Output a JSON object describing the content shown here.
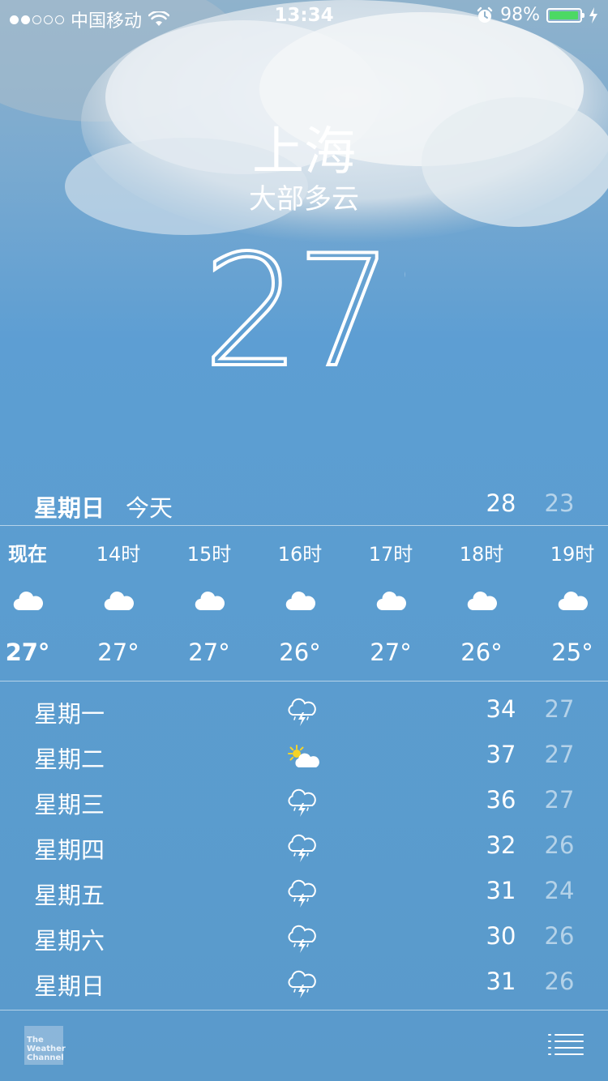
{
  "status_bar": {
    "carrier": "中国移动",
    "time": "13:34",
    "battery": "98%",
    "battery_level": 0.98,
    "signal_bars_filled": 2,
    "signal_bars_total": 5,
    "icons": [
      "wifi-icon",
      "alarm-icon",
      "charging-bolt-icon"
    ]
  },
  "header": {
    "city": "上海",
    "condition": "大部多云",
    "temperature": "27°"
  },
  "today": {
    "day": "星期日",
    "label": "今天",
    "high": "28",
    "low": "23"
  },
  "hourly": [
    {
      "time": "现在",
      "icon": "cloud-icon",
      "temp": "27°"
    },
    {
      "time": "14时",
      "icon": "cloud-icon",
      "temp": "27°"
    },
    {
      "time": "15时",
      "icon": "cloud-icon",
      "temp": "27°"
    },
    {
      "time": "16时",
      "icon": "cloud-icon",
      "temp": "26°"
    },
    {
      "time": "17时",
      "icon": "cloud-icon",
      "temp": "27°"
    },
    {
      "time": "18时",
      "icon": "cloud-icon",
      "temp": "26°"
    },
    {
      "time": "19时",
      "icon": "cloud-icon",
      "temp": "25°"
    }
  ],
  "daily": [
    {
      "day": "星期一",
      "icon": "thunderstorm-icon",
      "high": "34",
      "low": "27"
    },
    {
      "day": "星期二",
      "icon": "partly-sunny-icon",
      "high": "37",
      "low": "27"
    },
    {
      "day": "星期三",
      "icon": "thunderstorm-icon",
      "high": "36",
      "low": "27"
    },
    {
      "day": "星期四",
      "icon": "thunderstorm-icon",
      "high": "32",
      "low": "26"
    },
    {
      "day": "星期五",
      "icon": "thunderstorm-icon",
      "high": "31",
      "low": "24"
    },
    {
      "day": "星期六",
      "icon": "thunderstorm-icon",
      "high": "30",
      "low": "26"
    },
    {
      "day": "星期日",
      "icon": "thunderstorm-icon",
      "high": "31",
      "low": "26"
    }
  ],
  "footer": {
    "logo_lines": [
      "The",
      "Weather",
      "Channel"
    ],
    "list_icon": "list-icon"
  },
  "colors": {
    "sky_top": "#8fb2cc",
    "sky_bottom": "#5a9acb",
    "battery_fill": "#4cd964",
    "sun": "#f5d327",
    "text": "#ffffff"
  }
}
